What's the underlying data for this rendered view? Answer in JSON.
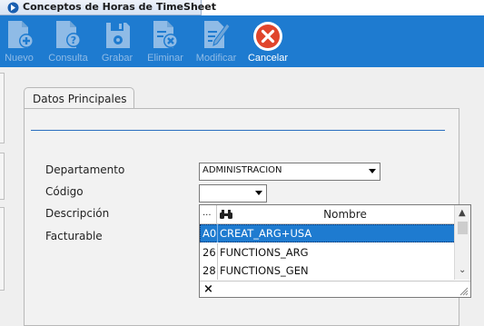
{
  "window": {
    "title": "Conceptos de Horas de TimeSheet"
  },
  "toolbar": {
    "buttons": [
      {
        "label": "Nuevo",
        "icon": "new-document-icon",
        "enabled": false
      },
      {
        "label": "Consulta",
        "icon": "query-document-icon",
        "enabled": false
      },
      {
        "label": "Grabar",
        "icon": "save-disk-icon",
        "enabled": false
      },
      {
        "label": "Eliminar",
        "icon": "delete-document-icon",
        "enabled": false
      },
      {
        "label": "Modificar",
        "icon": "edit-pencil-icon",
        "enabled": false
      },
      {
        "label": "Cancelar",
        "icon": "cancel-circle-icon",
        "enabled": true
      }
    ],
    "colors": {
      "background": "#1e7bd0",
      "cancel_red": "#e0452c"
    }
  },
  "tab": {
    "label": "Datos Principales"
  },
  "form": {
    "departamento": {
      "label": "Departamento",
      "value": "ADMINISTRACION"
    },
    "codigo": {
      "label": "Código",
      "value": ""
    },
    "descripcion": {
      "label": "Descripción"
    },
    "facturable": {
      "label": "Facturable"
    }
  },
  "dropdown": {
    "header": {
      "code_col": "...",
      "name_col": "Nombre"
    },
    "rows": [
      {
        "code": "A0",
        "name": "CREAT_ARG+USA",
        "selected": true
      },
      {
        "code": "26",
        "name": "FUNCTIONS_ARG",
        "selected": false
      },
      {
        "code": "28",
        "name": "FUNCTIONS_GEN",
        "selected": false
      }
    ],
    "footer_close": "×"
  }
}
